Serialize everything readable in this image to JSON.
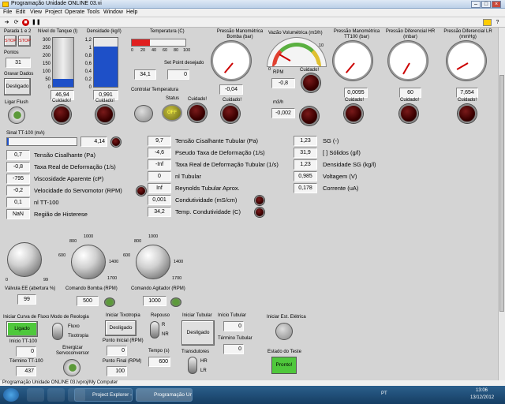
{
  "window": {
    "title": "Programação Unidade ONLINE 03.vi"
  },
  "menu": [
    "File",
    "Edit",
    "View",
    "Project",
    "Operate",
    "Tools",
    "Window",
    "Help"
  ],
  "top": {
    "parada_label": "Parada 1 e 2",
    "stop1": "STOP",
    "stop2": "STOP",
    "pontos_label": "Pontos",
    "pontos": "31",
    "gravar_label": "Gravar Dados",
    "desligado": "Desligado",
    "ligar_flush": "Ligar Flush",
    "nivel_label": "Nível do Tanque (l)",
    "nivel_val": "46,94",
    "nivel_ticks": [
      "300",
      "250",
      "200",
      "150",
      "100",
      "50",
      "0"
    ],
    "nivel_level": 0.16,
    "dens_label": "Densidade (kg/l)",
    "dens_val": "0,991",
    "dens_ticks": [
      "1,2",
      "1",
      "0,8",
      "0,6",
      "0,4",
      "0,2",
      "0"
    ],
    "dens_level": 0.82,
    "temp_label": "Temperatura (C)",
    "temp_ticks": [
      "0",
      "20",
      "40",
      "60",
      "80",
      "100"
    ],
    "temp_val": "34,1",
    "temp_level": 0.34,
    "setpoint_label": "Set Point desejado",
    "setpoint_val": "0",
    "controlar_label": "Controlar Temperatura",
    "status_label": "Status",
    "off": "OFF",
    "cuidado": "Cuidado!",
    "pressao_bomba_label": "Pressão Manométrica Bomba (bar)",
    "pressao_bomba_val": "-0,04",
    "pressao_bomba_ticks": [
      "0",
      "1",
      "2",
      "3",
      "4",
      "5",
      "6"
    ],
    "vazao_label": "Vazão Volumétrica (m3/h)",
    "vazao_ticks": [
      "0",
      "2",
      "4",
      "6",
      "8",
      "10"
    ],
    "rpm_label": "RPM",
    "rpm_val": "-0,8",
    "m3h_label": "m3/h",
    "m3h_val": "-0,002",
    "pressao_tt100_label": "Pressão Manométrica TT100 (bar)",
    "pressao_tt100_val": "0,0095",
    "pressao_tt100_ticks": [
      "0",
      "1",
      "2",
      "3",
      "4",
      "5",
      "6"
    ],
    "pressao_hr_label": "Pressão Diferencial HR (mbar)",
    "pressao_hr_val": "60",
    "pressao_hr_ticks": [
      "0",
      "100",
      "200",
      "300",
      "350",
      "400",
      "500"
    ],
    "pressao_lr_label": "Pressão Diferencial LR (mmHg)",
    "pressao_lr_val": "7,654",
    "pressao_lr_ticks": [
      "0",
      "5",
      "10",
      "15",
      "20",
      "25",
      "30",
      "37"
    ]
  },
  "sinal": {
    "label": "Sinal TT-100 (mA)",
    "val": "4,14",
    "level": 0.02
  },
  "col1": [
    {
      "v": "0,7",
      "l": "Tensão Cisalhante (Pa)"
    },
    {
      "v": "-0,8",
      "l": "Taxa Real de Deformação (1/s)"
    },
    {
      "v": "-795",
      "l": "Viscosidade Aparente (cP)"
    },
    {
      "v": "-0,2",
      "l": "Velocidade do Servomotor (RPM)"
    },
    {
      "v": "0,1",
      "l": "nl TT-100"
    },
    {
      "v": "NaN",
      "l": "Região de Histerese"
    }
  ],
  "col2": [
    {
      "v": "9,7",
      "l": "Tensão Cisalhante Tubular (Pa)"
    },
    {
      "v": "-4,6",
      "l": "Pseudo Taxa de Deformação (1/s)"
    },
    {
      "v": "-Inf",
      "l": "Taxa Real de Deformação Tubular (1/s)"
    },
    {
      "v": "0",
      "l": "nl Tubular"
    },
    {
      "v": "Inf",
      "l": "Reynolds Tubular Aprox."
    },
    {
      "v": "0,001",
      "l": "Condutividade (mS/cm)"
    },
    {
      "v": "34,2",
      "l": "Temp. Condutividade (C)"
    }
  ],
  "col3": [
    {
      "v": "1,23",
      "l": "SG (-)"
    },
    {
      "v": "31,9",
      "l": "[ ] Sólidos (g/l)"
    },
    {
      "v": "1,23",
      "l": "Densidade SG (kg/l)"
    },
    {
      "v": "0,985",
      "l": "Voltagem (V)"
    },
    {
      "v": "0,178",
      "l": "Corrente (uA)"
    }
  ],
  "knobs": {
    "valvula_label": "Válvula EE (abertura %)",
    "valvula_val": "99",
    "valvula_ticks": [
      "0",
      "99"
    ],
    "bomba_label": "Comando Bomba (RPM)",
    "bomba_val": "500",
    "bomba_ticks": [
      "200",
      "400",
      "600",
      "800",
      "1000",
      "1200",
      "1400",
      "1600",
      "1700",
      "0"
    ],
    "agitador_label": "Comando Agitador (RPM)",
    "agitador_val": "1000",
    "agitador_ticks": [
      "200",
      "400",
      "600",
      "800",
      "1000",
      "1200",
      "1400",
      "1600",
      "1700",
      "0"
    ]
  },
  "bottom": {
    "curva_label": "Iniciar Curva de Fluxo",
    "ligado": "Ligado",
    "modo_label": "Modo de Reologia",
    "fluxo": "Fluxo",
    "tixotropia": "Tixotropia",
    "inicio_tt100_label": "Início TT-100",
    "inicio_tt100": "0",
    "termino_tt100_label": "Término TT-100",
    "termino_tt100": "437",
    "energizar_label": "Energizar Servoconversor",
    "tixo_label": "Iniciar Tixotropia",
    "desligado": "Desligado",
    "ponto_inicial_label": "Ponto Inicial (RPM)",
    "ponto_inicial": "0",
    "ponto_final_label": "Ponto Final (RPM)",
    "ponto_final": "100",
    "repouso_label": "Repouso",
    "r": "R",
    "nr": "NR",
    "tempo_label": "Tempo (s)",
    "tempo": "600",
    "tubular_label": "Iniciar Tubular",
    "tubular_btn": "Desligado",
    "inicio_tubular_label": "Início Tubular",
    "inicio_tubular": "0",
    "termino_tubular_label": "Término Tubular",
    "termino_tubular": "0",
    "transdutores_label": "Transdutores",
    "hr": "HR",
    "lr": "LR",
    "est_label": "Iniciar Est. Elétrica",
    "estado_label": "Estado do Teste",
    "pronto": "Pronto!"
  },
  "statusbar": {
    "path": "Programação Unidade ONLINE 03.lvproj/My Computer"
  },
  "taskbar": {
    "task1": "Project Explorer - ...",
    "task2": "Programação Unida...",
    "lang": "PT",
    "time": "13:06",
    "date": "13/12/2012"
  }
}
